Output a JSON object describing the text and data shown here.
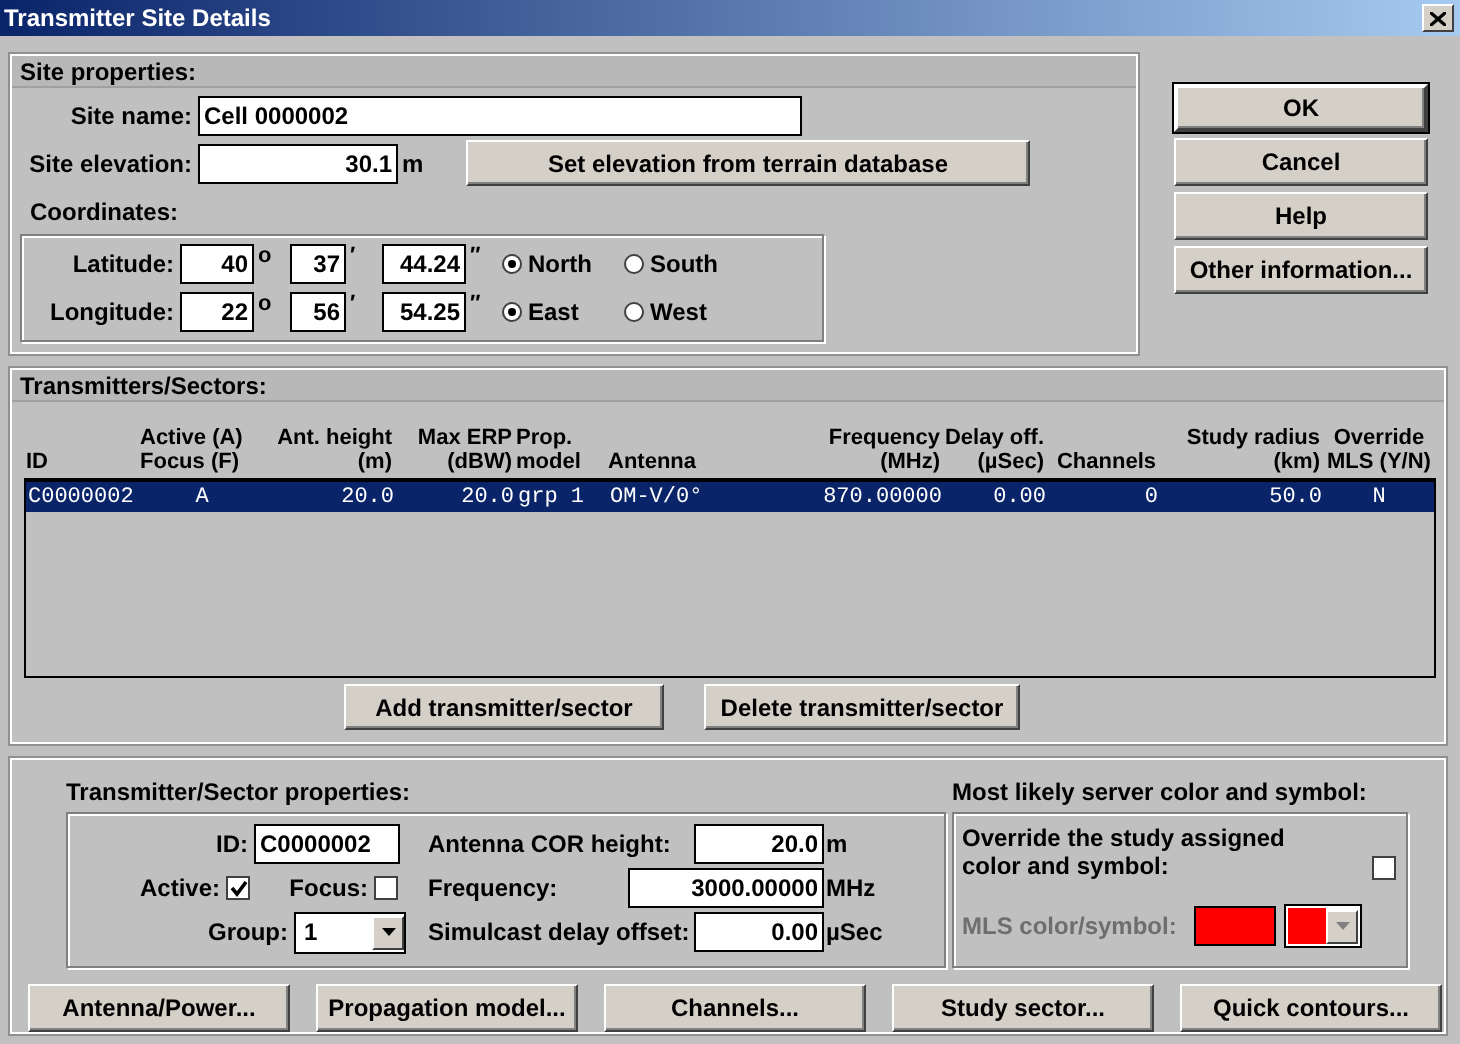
{
  "window": {
    "title": "Transmitter Site Details"
  },
  "site_properties": {
    "title": "Site properties:",
    "site_name": {
      "label": "Site name:",
      "value": "Cell 0000002"
    },
    "site_elevation": {
      "label": "Site elevation:",
      "value": "30.1",
      "unit": "m"
    },
    "terrain_button": "Set elevation from terrain database",
    "coordinates": {
      "label": "Coordinates:",
      "rows": [
        {
          "label": "Latitude:",
          "degrees": "40",
          "degree_mark": "o",
          "minutes": "37",
          "minute_mark": "′",
          "seconds": "44.24",
          "second_mark": "′′",
          "options": [
            {
              "label": "North",
              "selected": true
            },
            {
              "label": "South",
              "selected": false
            }
          ]
        },
        {
          "label": "Longitude:",
          "degrees": "22",
          "degree_mark": "o",
          "minutes": "56",
          "minute_mark": "′",
          "seconds": "54.25",
          "second_mark": "′′",
          "options": [
            {
              "label": "East",
              "selected": true
            },
            {
              "label": "West",
              "selected": false
            }
          ]
        }
      ]
    }
  },
  "dialog_buttons": [
    {
      "label": "OK",
      "default": true
    },
    {
      "label": "Cancel",
      "default": false
    },
    {
      "label": "Help",
      "default": false
    },
    {
      "label": "Other information...",
      "default": false
    }
  ],
  "transmitters": {
    "title": "Transmitters/Sectors:",
    "columns": [
      {
        "lines": [
          "ID"
        ]
      },
      {
        "lines": [
          "Active (A)",
          "Focus (F)"
        ]
      },
      {
        "lines": [
          "Ant. height",
          "(m)"
        ]
      },
      {
        "lines": [
          "Max ERP",
          "(dBW)"
        ]
      },
      {
        "lines": [
          "Prop.",
          "model"
        ]
      },
      {
        "lines": [
          "Antenna"
        ]
      },
      {
        "lines": [
          "Frequency",
          "(MHz)"
        ]
      },
      {
        "lines": [
          "Delay off.",
          "(µSec)"
        ]
      },
      {
        "lines": [
          "Channels"
        ]
      },
      {
        "lines": [
          "Study radius",
          "(km)"
        ]
      },
      {
        "lines": [
          "Override",
          "MLS (Y/N)"
        ]
      }
    ],
    "rows": [
      {
        "selected": true,
        "cells": [
          "C0000002",
          "A",
          "20.0",
          "20.0",
          "grp 1",
          "OM-V/0°",
          "870.00000",
          "0.00",
          "0",
          "50.0",
          "N"
        ]
      }
    ],
    "buttons": [
      "Add transmitter/sector",
      "Delete transmitter/sector"
    ]
  },
  "sector_properties": {
    "title": "Transmitter/Sector properties:",
    "id": {
      "label": "ID:",
      "value": "C0000002"
    },
    "active": {
      "label": "Active:",
      "checked": true
    },
    "focus": {
      "label": "Focus:",
      "checked": false
    },
    "group": {
      "label": "Group:",
      "value": "1"
    },
    "cor_height": {
      "label": "Antenna COR height:",
      "value": "20.0",
      "unit": "m"
    },
    "frequency": {
      "label": "Frequency:",
      "value": "3000.00000",
      "unit": "MHz"
    },
    "delay": {
      "label": "Simulcast delay offset:",
      "value": "0.00",
      "unit": "µSec"
    }
  },
  "mls": {
    "title": "Most likely server color and symbol:",
    "override": {
      "label": "Override the study assigned color and symbol:",
      "checked": false
    },
    "symbol": {
      "label": "MLS color/symbol:",
      "disabled": true,
      "color": "#ff0000"
    }
  },
  "bottom_buttons": [
    "Antenna/Power...",
    "Propagation model...",
    "Channels...",
    "Study sector...",
    "Quick contours..."
  ]
}
